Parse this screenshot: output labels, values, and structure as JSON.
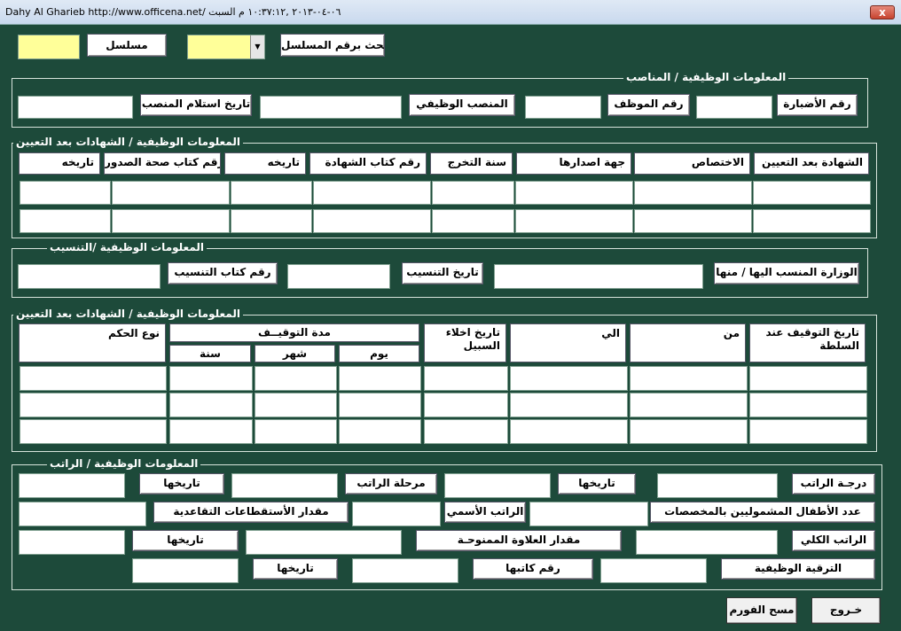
{
  "window": {
    "title": "Dahy Al Gharieb   http://www.officena.net/ ٠٦-٠٤-٢٠١٣ ,١٠:٣٧:١٢ م          السبت",
    "close_label": "x"
  },
  "search": {
    "search_label": "بحث برقم المسلسل",
    "serial_label": "مسلسل",
    "combo_value": "",
    "serial_value": "",
    "combo_arrow": "▼"
  },
  "positions": {
    "title": "المعلومات الوظيفية / المناصب",
    "labels": [
      "رقم الأضبارة",
      "رقم الموظف",
      "المنصب الوظيفي",
      "تاريخ استلام المنصب"
    ]
  },
  "certificates": {
    "title": "المعلومات الوظيفية / الشهادات بعد التعيين",
    "headers": [
      "الشهادة بعد التعيين",
      "الاختصاص",
      "جهة اصدارها",
      "سنة التخرج",
      "رقم كتاب الشهادة",
      "تاريخه",
      "رقم كتاب صحة الصدور",
      "تاريخه"
    ]
  },
  "transfer": {
    "title": "المعلومات الوظيفية /التنسيب",
    "labels": [
      "الوزارة المنسب اليها / منها",
      "تاريخ التنسيب",
      "رقم كتاب التنسيب"
    ]
  },
  "suspension": {
    "title": "المعلومات الوظيفية / الشهادات بعد التعيين",
    "headers": {
      "authority_date": "تاريخ التوقيف عند السلطة",
      "from": "من",
      "to": "الي",
      "release_date": "تاريخ اخلاء السبيل",
      "duration": "مدة التوقيــف",
      "day": "يوم",
      "month": "شهر",
      "year": "سنة",
      "verdict": "نوع الحكم"
    }
  },
  "salary": {
    "title": "المعلومات الوظيفية / الراتب",
    "labels": {
      "grade": "درجـة الراتب",
      "grade_date": "تاريخها",
      "stage": "مرحلة الراتب",
      "stage_date": "تاريخها",
      "children": "عدد الأطفال المشموليين بالمخصصات",
      "nominal": "الراتب الأسمي",
      "deductions": "مقدار الأستقطاعات التقاعدية",
      "total": "الراتب الكلي",
      "allowance": "مقدار العلاوة الممنوحـة",
      "allowance_date": "تاريخها",
      "promotion": "الترقية الوظيفية",
      "promotion_letter": "رقم كاتبها",
      "promotion_date": "تاريخها"
    }
  },
  "footer": {
    "exit": "خـروج",
    "clear": "مسح الفورم"
  }
}
